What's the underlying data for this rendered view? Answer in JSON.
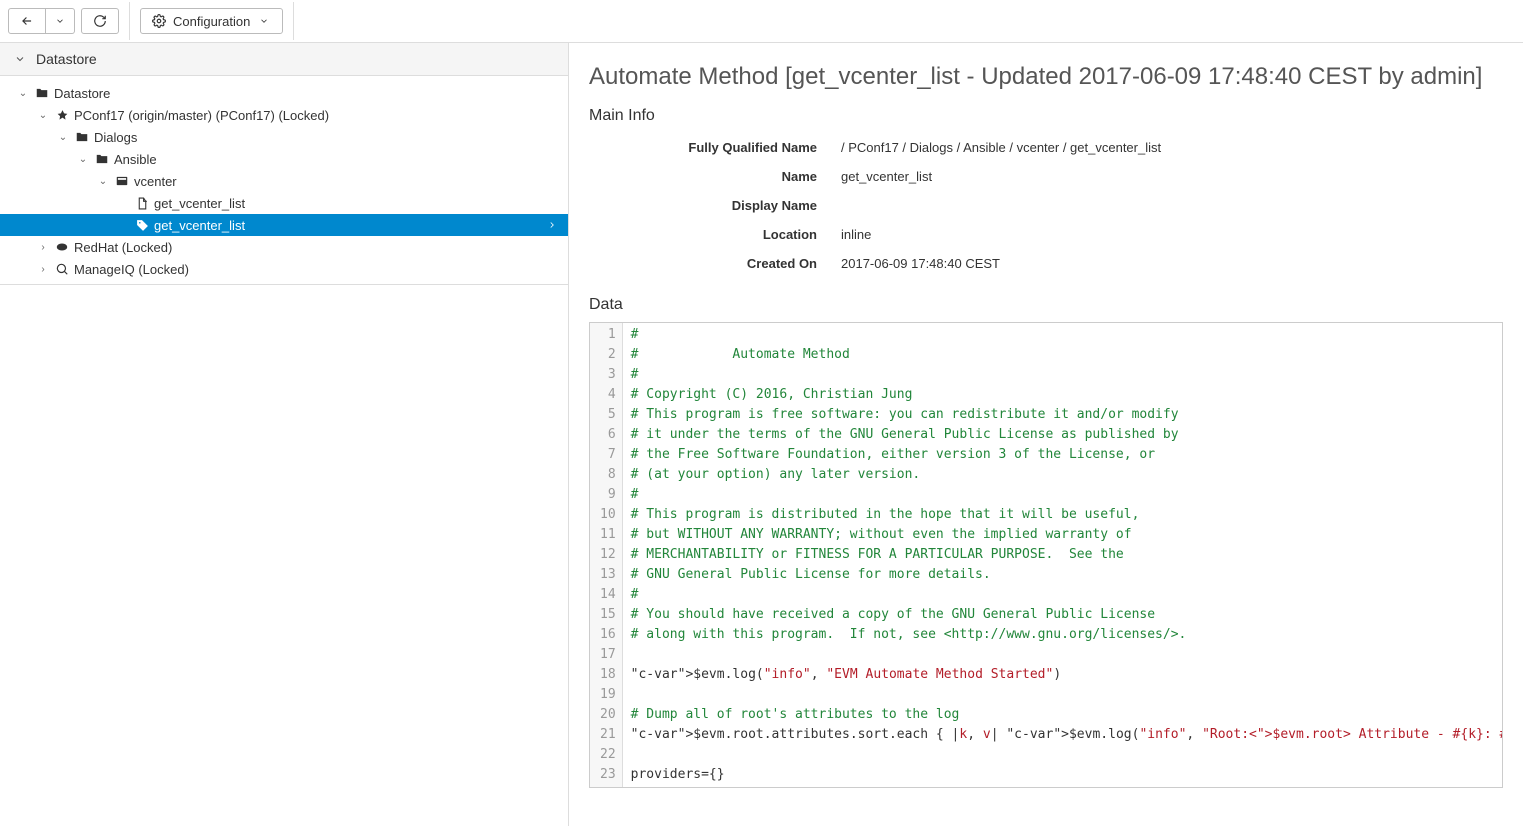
{
  "toolbar": {
    "configuration_label": "Configuration"
  },
  "sidebar": {
    "title": "Datastore",
    "tree": {
      "root": "Datastore",
      "pconf17": "PConf17 (origin/master) (PConf17) (Locked)",
      "dialogs": "Dialogs",
      "ansible": "Ansible",
      "vcenter": "vcenter",
      "method_doc": "get_vcenter_list",
      "method_tag": "get_vcenter_list",
      "redhat": "RedHat (Locked)",
      "manageiq": "ManageIQ (Locked)"
    }
  },
  "content": {
    "title": "Automate Method [get_vcenter_list - Updated 2017-06-09 17:48:40 CEST by admin]",
    "main_info_heading": "Main Info",
    "data_heading": "Data",
    "info": {
      "fqn_label": "Fully Qualified Name",
      "fqn_value": "/ PConf17 / Dialogs / Ansible / vcenter / get_vcenter_list",
      "name_label": "Name",
      "name_value": "get_vcenter_list",
      "display_name_label": "Display Name",
      "display_name_value": "",
      "location_label": "Location",
      "location_value": "inline",
      "created_on_label": "Created On",
      "created_on_value": "2017-06-09 17:48:40 CEST"
    },
    "code": [
      "#",
      "#            Automate Method",
      "#",
      "# Copyright (C) 2016, Christian Jung",
      "# This program is free software: you can redistribute it and/or modify",
      "# it under the terms of the GNU General Public License as published by",
      "# the Free Software Foundation, either version 3 of the License, or",
      "# (at your option) any later version.",
      "#",
      "# This program is distributed in the hope that it will be useful,",
      "# but WITHOUT ANY WARRANTY; without even the implied warranty of",
      "# MERCHANTABILITY or FITNESS FOR A PARTICULAR PURPOSE.  See the",
      "# GNU General Public License for more details.",
      "#",
      "# You should have received a copy of the GNU General Public License",
      "# along with this program.  If not, see <http://www.gnu.org/licenses/>.",
      "",
      "$evm.log(\"info\", \"EVM Automate Method Started\")",
      "",
      "# Dump all of root's attributes to the log",
      "$evm.root.attributes.sort.each { |k, v| $evm.log(\"info\", \"Root:<$evm.root> Attribute - #{k}: #{v}\")}",
      "",
      "providers={}"
    ]
  }
}
